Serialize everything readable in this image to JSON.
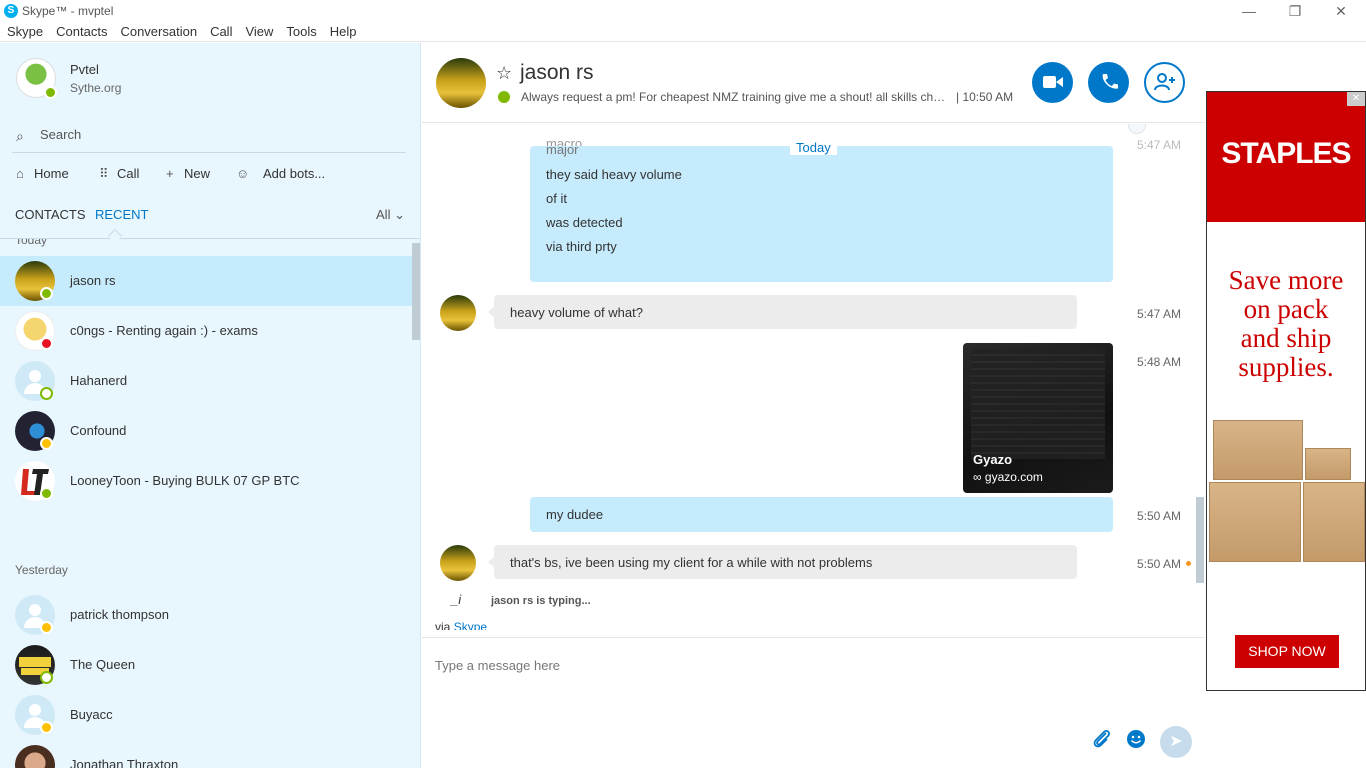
{
  "window": {
    "title": "Skype™ - mvptel",
    "logo": "S",
    "controls": {
      "minimize": "—",
      "maximize": "❐",
      "close": "✕"
    }
  },
  "menu": [
    "Skype",
    "Contacts",
    "Conversation",
    "Call",
    "View",
    "Tools",
    "Help"
  ],
  "profile": {
    "name": "Pvtel",
    "mood": "Sythe.org"
  },
  "search": {
    "icon": "search-icon",
    "label": "Search"
  },
  "nav": [
    {
      "icon": "home-icon",
      "glyph": "⌂",
      "label": "Home"
    },
    {
      "icon": "dialpad-icon",
      "glyph": "⠿",
      "label": "Call"
    },
    {
      "icon": "plus-icon",
      "glyph": "+",
      "label": "New"
    },
    {
      "icon": "bot-icon",
      "glyph": "☺",
      "label": "Add bots..."
    }
  ],
  "tabs": {
    "contacts": "CONTACTS",
    "recent": "RECENT",
    "filter": "All",
    "active_color": "#0078ca"
  },
  "contact_groups": {
    "today": "Today",
    "yesterday": "Yesterday"
  },
  "contacts": [
    {
      "name": "jason rs",
      "status": "online",
      "selected": true
    },
    {
      "name": "c0ngs - Renting again :) - exams",
      "status": "busy"
    },
    {
      "name": "Hahanerd",
      "status": "offline"
    },
    {
      "name": "Confound",
      "status": "away"
    },
    {
      "name": "LooneyToon - Buying BULK 07 GP BTC",
      "status": "online"
    },
    {
      "name": "patrick thompson",
      "status": "away"
    },
    {
      "name": "The Queen",
      "status": "offline"
    },
    {
      "name": "Buyacc",
      "status": "away"
    },
    {
      "name": "Jonathan Thraxton",
      "status": "away"
    }
  ],
  "chat": {
    "name": "jason rs",
    "mood": "Always request a pm! For cheapest NMZ training give me a shout! all skills char...",
    "local_time": "| 10:50 AM",
    "header_buttons": {
      "video": "video-call-icon",
      "call": "phone-icon",
      "add": "add-person-icon"
    },
    "today_label": "Today",
    "faded_lines": [
      "macro",
      "major"
    ],
    "faded_time": "5:47 AM",
    "outgoing_block": [
      "they said heavy volume",
      "of it",
      "was detected",
      "via third prty"
    ],
    "messages": [
      {
        "dir": "in",
        "text": "heavy volume of what?",
        "time": "5:47 AM"
      },
      {
        "dir": "out-image",
        "title": "Gyazo",
        "link": "gyazo.com",
        "time": "5:48 AM"
      },
      {
        "dir": "out",
        "text": "my dudee",
        "time": "5:50 AM"
      },
      {
        "dir": "in",
        "text": "that's bs, ive been using my client for a while with not problems",
        "time": "5:50 AM"
      }
    ],
    "typing": "jason rs is typing...",
    "typing_icon": "_i",
    "via_prefix": "via",
    "via_link": "Skype"
  },
  "composer": {
    "placeholder": "Type a message here",
    "attach_icon": "paperclip-icon",
    "emoji_icon": "emoticon-icon",
    "send_icon": "send-icon"
  },
  "ad": {
    "brand": "STAPLES",
    "tagline": [
      "Save more",
      "on pack",
      "and ship",
      "supplies."
    ],
    "cta": "SHOP NOW",
    "brand_color": "#cc0000",
    "close": "✕"
  }
}
